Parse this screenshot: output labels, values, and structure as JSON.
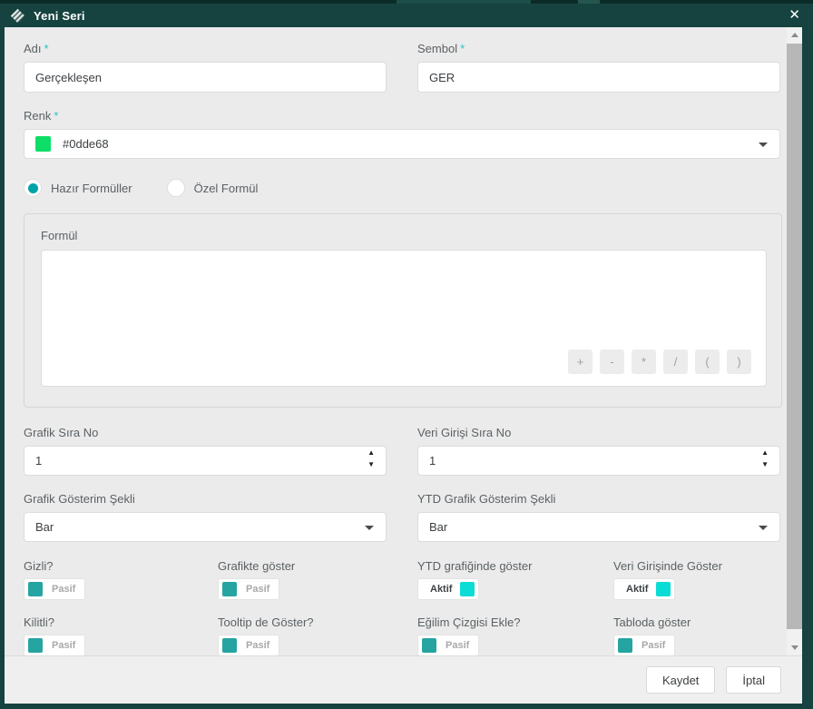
{
  "modal": {
    "title": "Yeni Seri",
    "close_icon": "✕"
  },
  "fields": {
    "name": {
      "label": "Adı",
      "required_mark": "*",
      "value": "Gerçekleşen"
    },
    "symbol": {
      "label": "Sembol",
      "required_mark": "*",
      "value": "GER"
    },
    "color": {
      "label": "Renk",
      "required_mark": "*",
      "value": "#0dde68",
      "swatch": "#0dde68"
    },
    "formula_mode": {
      "options": [
        {
          "label": "Hazır Formüller",
          "selected": true
        },
        {
          "label": "Özel Formül",
          "selected": false
        }
      ]
    },
    "formula": {
      "label": "Formül",
      "value": "",
      "operators": [
        "+",
        "-",
        "*",
        "/",
        "(",
        ")"
      ]
    },
    "chart_order": {
      "label": "Grafik Sıra No",
      "value": "1"
    },
    "entry_order": {
      "label": "Veri Girişi Sıra No",
      "value": "1"
    },
    "chart_type": {
      "label": "Grafik Gösterim Şekli",
      "value": "Bar"
    },
    "ytd_chart_type": {
      "label": "YTD Grafik Gösterim Şekli",
      "value": "Bar"
    },
    "toggles_row1": [
      {
        "label": "Gizli?",
        "state": "Pasif",
        "active": false
      },
      {
        "label": "Grafikte göster",
        "state": "Pasif",
        "active": false
      },
      {
        "label": "YTD grafiğinde göster",
        "state": "Aktif",
        "active": true
      },
      {
        "label": "Veri Girişinde Göster",
        "state": "Aktif",
        "active": true
      }
    ],
    "toggles_row2": [
      {
        "label": "Kilitli?",
        "state": "Pasif",
        "active": false
      },
      {
        "label": "Tooltip de Göster?",
        "state": "Pasif",
        "active": false
      },
      {
        "label": "Eğilim Çizgisi Ekle?",
        "state": "Pasif",
        "active": false
      },
      {
        "label": "Tabloda göster",
        "state": "Pasif",
        "active": false
      }
    ]
  },
  "footer": {
    "save_label": "Kaydet",
    "cancel_label": "İptal"
  },
  "colors": {
    "header_teal": "#16433f",
    "body_gray": "#ebebeb",
    "accent_teal": "#00a3a9",
    "toggle_off_knob": "#26a4a1",
    "toggle_on_knob": "#0cdcd6",
    "required_mark": "#2bc1c9",
    "series_color": "#0dde68"
  }
}
